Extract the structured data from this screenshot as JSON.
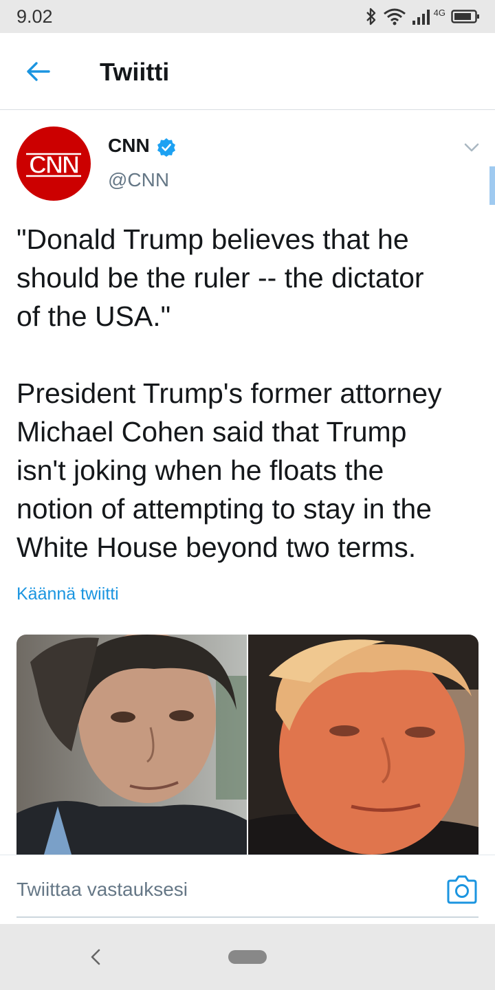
{
  "status_bar": {
    "time": "9.02",
    "network_label": "4G",
    "icons": [
      "bluetooth-icon",
      "wifi-icon",
      "signal-icon",
      "battery-icon"
    ]
  },
  "header": {
    "title": "Twiitti",
    "back_icon": "back-arrow-icon"
  },
  "tweet": {
    "author_name": "CNN",
    "author_handle": "@CNN",
    "verified": true,
    "avatar_text": "CNN",
    "paragraphs": [
      "\"Donald Trump believes that he\nshould be the ruler -- the dictator\nof the USA.\"",
      "President Trump's former attorney\nMichael Cohen said that Trump\nisn't joking when he floats the\nnotion of attempting to stay in the\nWhite House beyond two terms."
    ],
    "translate_label": "Käännä twiitti",
    "media_count": 2
  },
  "reply": {
    "placeholder": "Twiittaa vastauksesi",
    "camera_icon": "camera-icon"
  },
  "colors": {
    "brand_blue": "#1b95e0",
    "cnn_red": "#cc0000",
    "text_primary": "#14171a",
    "text_secondary": "#657786"
  }
}
